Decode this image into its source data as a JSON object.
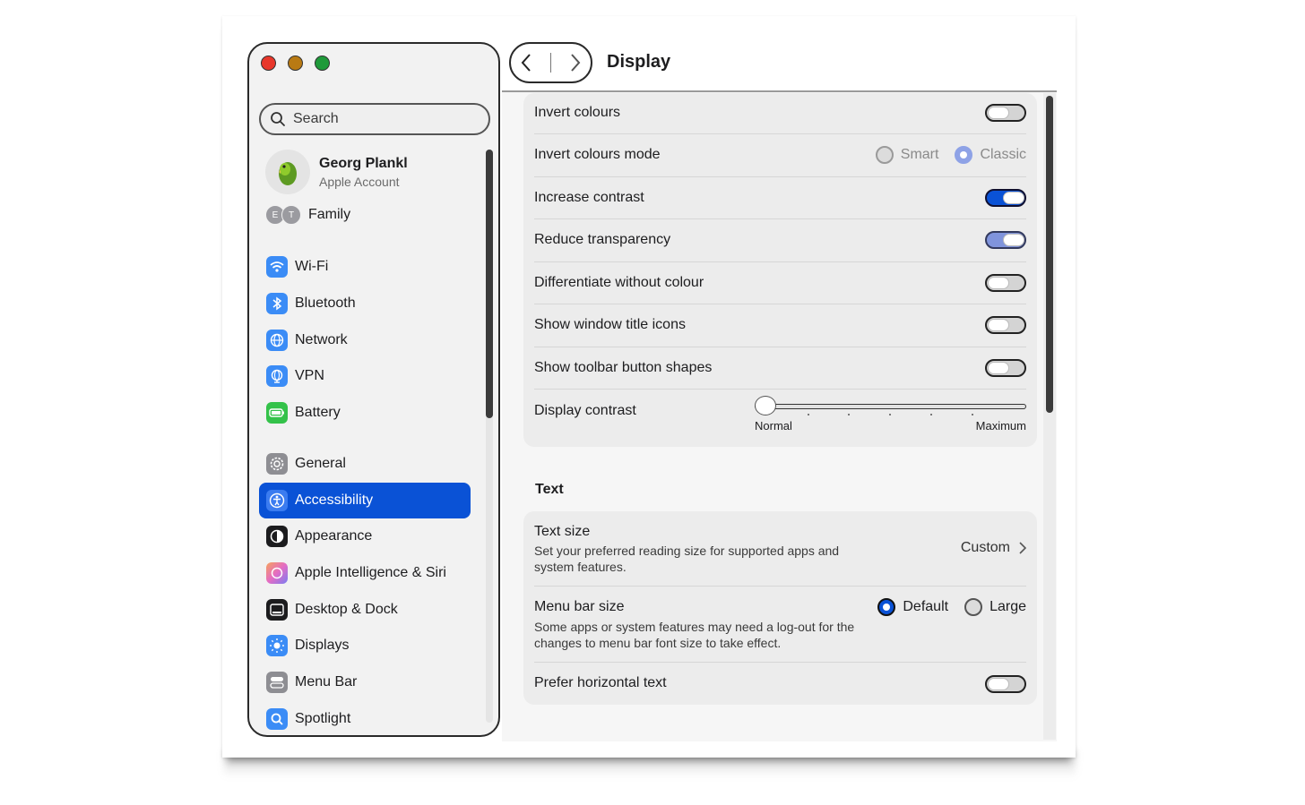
{
  "sidebar": {
    "search_placeholder": "Search",
    "account": {
      "name": "Georg Plankl",
      "subtitle": "Apple Account"
    },
    "family": {
      "initials": [
        "E",
        "T"
      ],
      "label": "Family"
    },
    "items": [
      {
        "label": "Wi-Fi",
        "icon": "wifi-icon",
        "color": "#3b8cf6"
      },
      {
        "label": "Bluetooth",
        "icon": "bluetooth-icon",
        "color": "#3b8cf6"
      },
      {
        "label": "Network",
        "icon": "globe-icon",
        "color": "#3b8cf6"
      },
      {
        "label": "VPN",
        "icon": "vpn-globe-icon",
        "color": "#3b8cf6"
      },
      {
        "label": "Battery",
        "icon": "battery-icon",
        "color": "#34c24a"
      },
      {
        "label": "General",
        "icon": "gear-icon",
        "color": "#8e8e93"
      },
      {
        "label": "Accessibility",
        "icon": "accessibility-icon",
        "color": "#0a52d6",
        "selected": true
      },
      {
        "label": "Appearance",
        "icon": "appearance-icon",
        "color": "#1c1c1e"
      },
      {
        "label": "Apple Intelligence & Siri",
        "icon": "siri-icon",
        "color": "#e46cc4"
      },
      {
        "label": "Desktop & Dock",
        "icon": "dock-icon",
        "color": "#1c1c1e"
      },
      {
        "label": "Displays",
        "icon": "brightness-icon",
        "color": "#3b8cf6"
      },
      {
        "label": "Menu Bar",
        "icon": "menubar-icon",
        "color": "#8e8e93"
      },
      {
        "label": "Spotlight",
        "icon": "spotlight-icon",
        "color": "#3b8cf6"
      }
    ]
  },
  "header": {
    "title": "Display"
  },
  "display": {
    "invert_colours": {
      "label": "Invert colours",
      "on": false
    },
    "invert_mode": {
      "label": "Invert colours mode",
      "options": [
        "Smart",
        "Classic"
      ],
      "selected": "Classic"
    },
    "increase_contrast": {
      "label": "Increase contrast",
      "on": true
    },
    "reduce_transparency": {
      "label": "Reduce transparency",
      "on": true
    },
    "differentiate": {
      "label": "Differentiate without colour",
      "on": false
    },
    "window_title_icons": {
      "label": "Show window title icons",
      "on": false
    },
    "toolbar_shapes": {
      "label": "Show toolbar button shapes",
      "on": false
    },
    "display_contrast": {
      "label": "Display contrast",
      "min_label": "Normal",
      "max_label": "Maximum",
      "value": 0
    }
  },
  "text_section": {
    "title": "Text",
    "text_size": {
      "label": "Text size",
      "description": "Set your preferred reading size for supported apps and system features.",
      "value": "Custom"
    },
    "menu_bar_size": {
      "label": "Menu bar size",
      "description": "Some apps or system features may need a log-out for the changes to menu bar font size to take effect.",
      "options": [
        "Default",
        "Large"
      ],
      "selected": "Default"
    },
    "prefer_horizontal": {
      "label": "Prefer horizontal text",
      "on": false
    }
  }
}
